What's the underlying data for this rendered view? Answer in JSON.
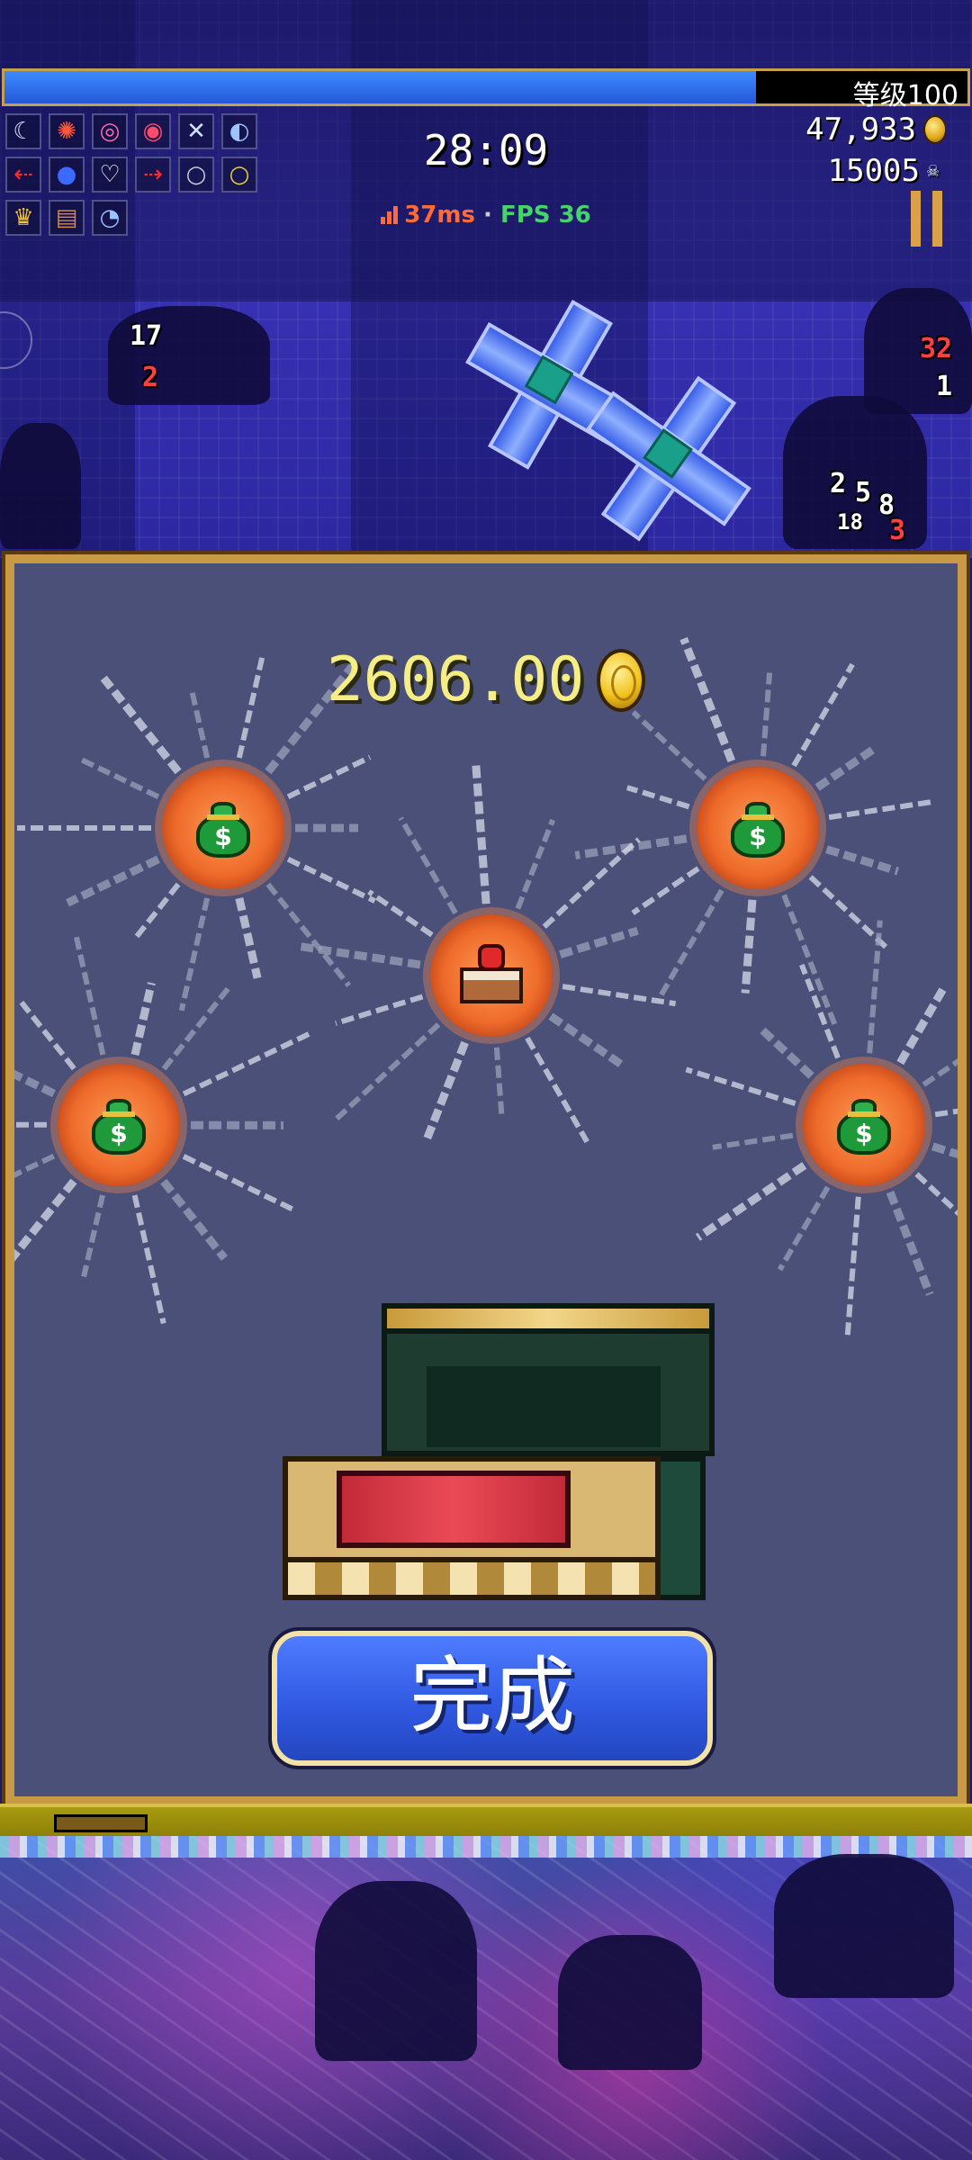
{
  "hud": {
    "level_label": "等级100",
    "xp_progress": 0.78,
    "timer": "28:09",
    "ping": "37ms",
    "separator": "·",
    "fps": "FPS 36",
    "gold": "47,933",
    "kills": "15005"
  },
  "weapon_slots": [
    {
      "icon": "crescent-icon",
      "glyph": "☾",
      "color": "#dfe6ff"
    },
    {
      "icon": "fireworks-icon",
      "glyph": "✺",
      "color": "#ff5a3a"
    },
    {
      "icon": "target-icon",
      "glyph": "◎",
      "color": "#ff6aa8"
    },
    {
      "icon": "vortex-icon",
      "glyph": "◉",
      "color": "#ff4a6a"
    },
    {
      "icon": "crossed-swords-icon",
      "glyph": "✕",
      "color": "#cfe2ff"
    },
    {
      "icon": "swirl-orb-icon",
      "glyph": "◐",
      "color": "#9ec4ff"
    },
    {
      "icon": "red-arrow-icon",
      "glyph": "⇠",
      "color": "#ff2a2a"
    },
    {
      "icon": "blue-orb-icon",
      "glyph": "●",
      "color": "#3a6aff"
    },
    {
      "icon": "heart-icon",
      "glyph": "♡",
      "color": "#ffffff"
    },
    {
      "icon": "red-arrow-right-icon",
      "glyph": "⇢",
      "color": "#ff2a2a"
    },
    {
      "icon": "silver-ring-icon",
      "glyph": "○",
      "color": "#c8ccdd"
    },
    {
      "icon": "gold-ring-icon",
      "glyph": "○",
      "color": "#e8d040"
    },
    {
      "icon": "crown-icon",
      "glyph": "♛",
      "color": "#f2c23a"
    },
    {
      "icon": "tome-icon",
      "glyph": "▤",
      "color": "#d08a4a"
    },
    {
      "icon": "clock-icon",
      "glyph": "◔",
      "color": "#9ec4ff"
    }
  ],
  "dialog": {
    "gold_amount": "2606.00",
    "done_label": "完成",
    "rewards": [
      {
        "type": "money-bag",
        "sign": "$"
      },
      {
        "type": "money-bag",
        "sign": "$"
      },
      {
        "type": "cake"
      },
      {
        "type": "money-bag",
        "sign": "$"
      },
      {
        "type": "money-bag",
        "sign": "$"
      }
    ]
  },
  "floating_numbers": [
    "17",
    "2",
    "32",
    "1",
    "2",
    "5",
    "8",
    "18",
    "3"
  ],
  "colors": {
    "accent_gold": "#c99a46",
    "button_blue": "#2f57e0",
    "panel_bg": "#4a5078",
    "xp_blue": "#2458d8"
  }
}
